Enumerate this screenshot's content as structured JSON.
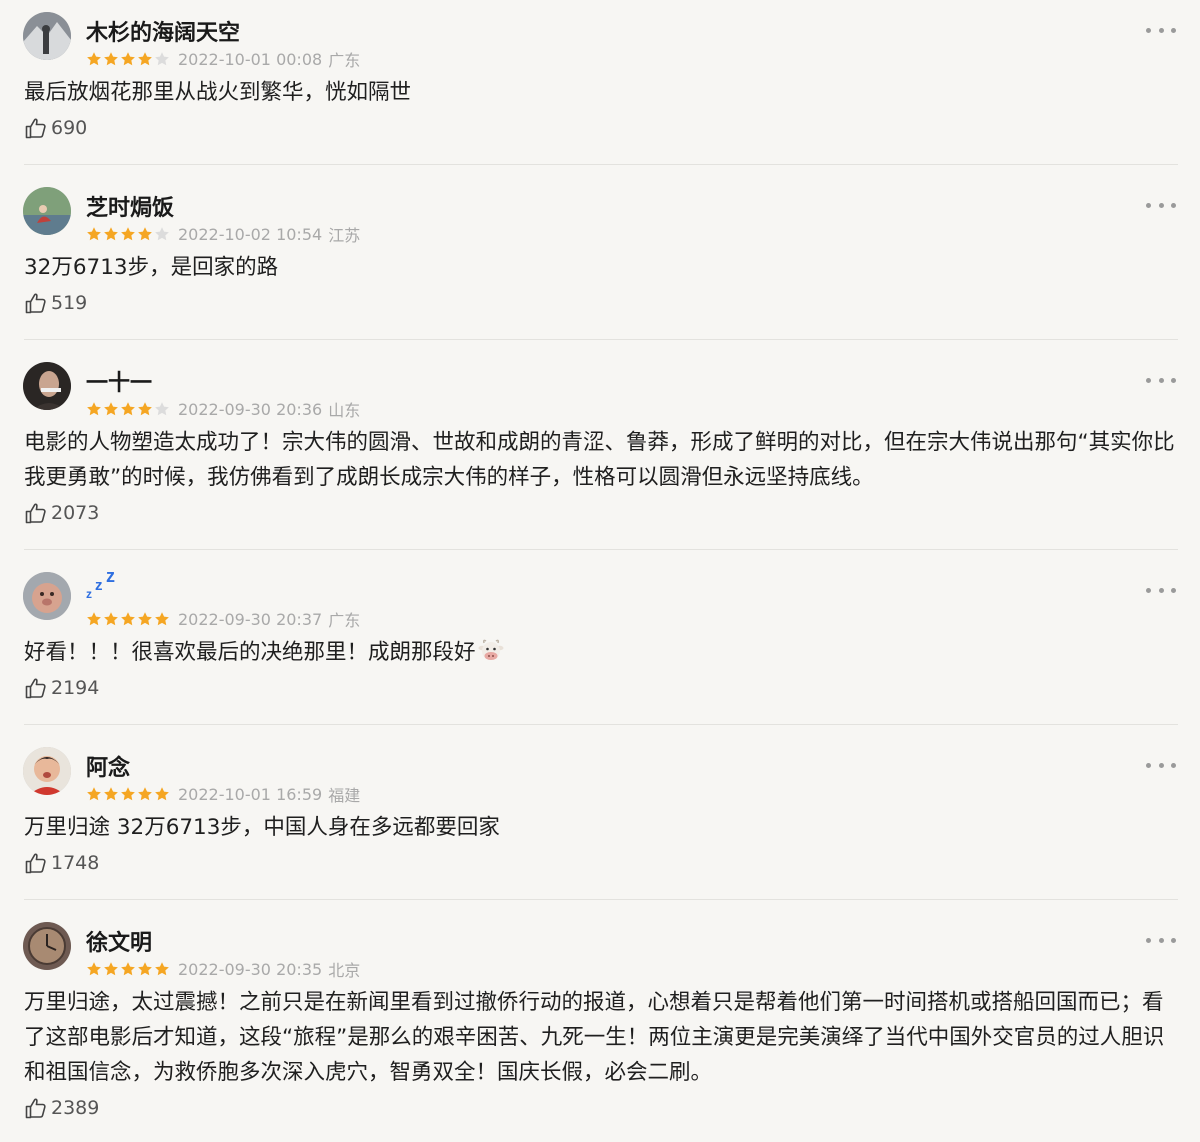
{
  "comments": [
    {
      "username": "木杉的海阔天空",
      "rating": 4,
      "time": "2022-10-01 00:08",
      "region": "广东",
      "text": "最后放烟花那里从战火到繁华，恍如隔世",
      "likes": "690",
      "avatar_colors": [
        "#8a8f96",
        "#3b3d40"
      ]
    },
    {
      "username": "芝时焗饭",
      "rating": 4,
      "time": "2022-10-02 10:54",
      "region": "江苏",
      "text": "32万6713步，是回家的路",
      "likes": "519",
      "avatar_colors": [
        "#7fa07a",
        "#c0413b"
      ]
    },
    {
      "username": "一十一",
      "rating": 4,
      "time": "2022-09-30 20:36",
      "region": "山东",
      "text": "电影的人物塑造太成功了！宗大伟的圆滑、世故和成朗的青涩、鲁莽，形成了鲜明的对比，但在宗大伟说出那句“其实你比我更勇敢”的时候，我仿佛看到了成朗长成宗大伟的样子，性格可以圆滑但永远坚持底线。",
      "likes": "2073",
      "avatar_colors": [
        "#2a2624",
        "#c9a590"
      ]
    },
    {
      "username": "",
      "rating": 5,
      "time": "2022-09-30 20:37",
      "region": "广东",
      "text": "好看！！！很喜欢最后的决绝那里！成朗那段好",
      "likes": "2194",
      "avatar_colors": [
        "#a3a8ae",
        "#d7a38f"
      ]
    },
    {
      "username": "阿念",
      "rating": 5,
      "time": "2022-10-01 16:59",
      "region": "福建",
      "text": "万里归途 32万6713步，中国人身在多远都要回家",
      "likes": "1748",
      "avatar_colors": [
        "#e9e4dc",
        "#d0382e"
      ]
    },
    {
      "username": "徐文明",
      "rating": 5,
      "time": "2022-09-30 20:35",
      "region": "北京",
      "text": "万里归途，太过震撼！之前只是在新闻里看到过撤侨行动的报道，心想着只是帮着他们第一时间搭机或搭船回国而已；看了这部电影后才知道，这段“旅程”是那么的艰辛困苦、九死一生！两位主演更是完美演绎了当代中国外交官员的过人胆识和祖国信念，为救侨胞多次深入虎穴，智勇双全！国庆长假，必会二刷。",
      "likes": "2389",
      "avatar_colors": [
        "#6e5a52",
        "#a88a72"
      ]
    }
  ],
  "icons": {
    "star": "star-icon",
    "like": "thumbs-up-icon",
    "more": "more-dots-icon",
    "sleep": "zzz-icon",
    "cow": "cow-face-emoji"
  },
  "colors": {
    "star_filled": "#f5a623",
    "star_empty": "#dcdcdc",
    "sleep_blue": "#2f6fe0"
  }
}
